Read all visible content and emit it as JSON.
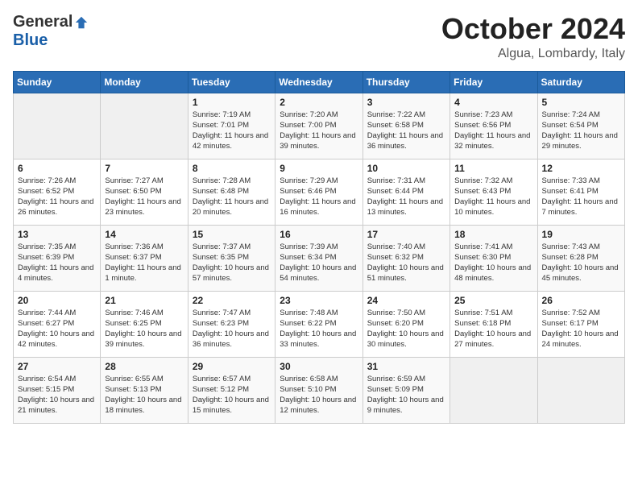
{
  "header": {
    "logo_general": "General",
    "logo_blue": "Blue",
    "month_title": "October 2024",
    "location": "Algua, Lombardy, Italy"
  },
  "weekdays": [
    "Sunday",
    "Monday",
    "Tuesday",
    "Wednesday",
    "Thursday",
    "Friday",
    "Saturday"
  ],
  "weeks": [
    [
      {
        "day": "",
        "info": ""
      },
      {
        "day": "",
        "info": ""
      },
      {
        "day": "1",
        "info": "Sunrise: 7:19 AM\nSunset: 7:01 PM\nDaylight: 11 hours and 42 minutes."
      },
      {
        "day": "2",
        "info": "Sunrise: 7:20 AM\nSunset: 7:00 PM\nDaylight: 11 hours and 39 minutes."
      },
      {
        "day": "3",
        "info": "Sunrise: 7:22 AM\nSunset: 6:58 PM\nDaylight: 11 hours and 36 minutes."
      },
      {
        "day": "4",
        "info": "Sunrise: 7:23 AM\nSunset: 6:56 PM\nDaylight: 11 hours and 32 minutes."
      },
      {
        "day": "5",
        "info": "Sunrise: 7:24 AM\nSunset: 6:54 PM\nDaylight: 11 hours and 29 minutes."
      }
    ],
    [
      {
        "day": "6",
        "info": "Sunrise: 7:26 AM\nSunset: 6:52 PM\nDaylight: 11 hours and 26 minutes."
      },
      {
        "day": "7",
        "info": "Sunrise: 7:27 AM\nSunset: 6:50 PM\nDaylight: 11 hours and 23 minutes."
      },
      {
        "day": "8",
        "info": "Sunrise: 7:28 AM\nSunset: 6:48 PM\nDaylight: 11 hours and 20 minutes."
      },
      {
        "day": "9",
        "info": "Sunrise: 7:29 AM\nSunset: 6:46 PM\nDaylight: 11 hours and 16 minutes."
      },
      {
        "day": "10",
        "info": "Sunrise: 7:31 AM\nSunset: 6:44 PM\nDaylight: 11 hours and 13 minutes."
      },
      {
        "day": "11",
        "info": "Sunrise: 7:32 AM\nSunset: 6:43 PM\nDaylight: 11 hours and 10 minutes."
      },
      {
        "day": "12",
        "info": "Sunrise: 7:33 AM\nSunset: 6:41 PM\nDaylight: 11 hours and 7 minutes."
      }
    ],
    [
      {
        "day": "13",
        "info": "Sunrise: 7:35 AM\nSunset: 6:39 PM\nDaylight: 11 hours and 4 minutes."
      },
      {
        "day": "14",
        "info": "Sunrise: 7:36 AM\nSunset: 6:37 PM\nDaylight: 11 hours and 1 minute."
      },
      {
        "day": "15",
        "info": "Sunrise: 7:37 AM\nSunset: 6:35 PM\nDaylight: 10 hours and 57 minutes."
      },
      {
        "day": "16",
        "info": "Sunrise: 7:39 AM\nSunset: 6:34 PM\nDaylight: 10 hours and 54 minutes."
      },
      {
        "day": "17",
        "info": "Sunrise: 7:40 AM\nSunset: 6:32 PM\nDaylight: 10 hours and 51 minutes."
      },
      {
        "day": "18",
        "info": "Sunrise: 7:41 AM\nSunset: 6:30 PM\nDaylight: 10 hours and 48 minutes."
      },
      {
        "day": "19",
        "info": "Sunrise: 7:43 AM\nSunset: 6:28 PM\nDaylight: 10 hours and 45 minutes."
      }
    ],
    [
      {
        "day": "20",
        "info": "Sunrise: 7:44 AM\nSunset: 6:27 PM\nDaylight: 10 hours and 42 minutes."
      },
      {
        "day": "21",
        "info": "Sunrise: 7:46 AM\nSunset: 6:25 PM\nDaylight: 10 hours and 39 minutes."
      },
      {
        "day": "22",
        "info": "Sunrise: 7:47 AM\nSunset: 6:23 PM\nDaylight: 10 hours and 36 minutes."
      },
      {
        "day": "23",
        "info": "Sunrise: 7:48 AM\nSunset: 6:22 PM\nDaylight: 10 hours and 33 minutes."
      },
      {
        "day": "24",
        "info": "Sunrise: 7:50 AM\nSunset: 6:20 PM\nDaylight: 10 hours and 30 minutes."
      },
      {
        "day": "25",
        "info": "Sunrise: 7:51 AM\nSunset: 6:18 PM\nDaylight: 10 hours and 27 minutes."
      },
      {
        "day": "26",
        "info": "Sunrise: 7:52 AM\nSunset: 6:17 PM\nDaylight: 10 hours and 24 minutes."
      }
    ],
    [
      {
        "day": "27",
        "info": "Sunrise: 6:54 AM\nSunset: 5:15 PM\nDaylight: 10 hours and 21 minutes."
      },
      {
        "day": "28",
        "info": "Sunrise: 6:55 AM\nSunset: 5:13 PM\nDaylight: 10 hours and 18 minutes."
      },
      {
        "day": "29",
        "info": "Sunrise: 6:57 AM\nSunset: 5:12 PM\nDaylight: 10 hours and 15 minutes."
      },
      {
        "day": "30",
        "info": "Sunrise: 6:58 AM\nSunset: 5:10 PM\nDaylight: 10 hours and 12 minutes."
      },
      {
        "day": "31",
        "info": "Sunrise: 6:59 AM\nSunset: 5:09 PM\nDaylight: 10 hours and 9 minutes."
      },
      {
        "day": "",
        "info": ""
      },
      {
        "day": "",
        "info": ""
      }
    ]
  ]
}
